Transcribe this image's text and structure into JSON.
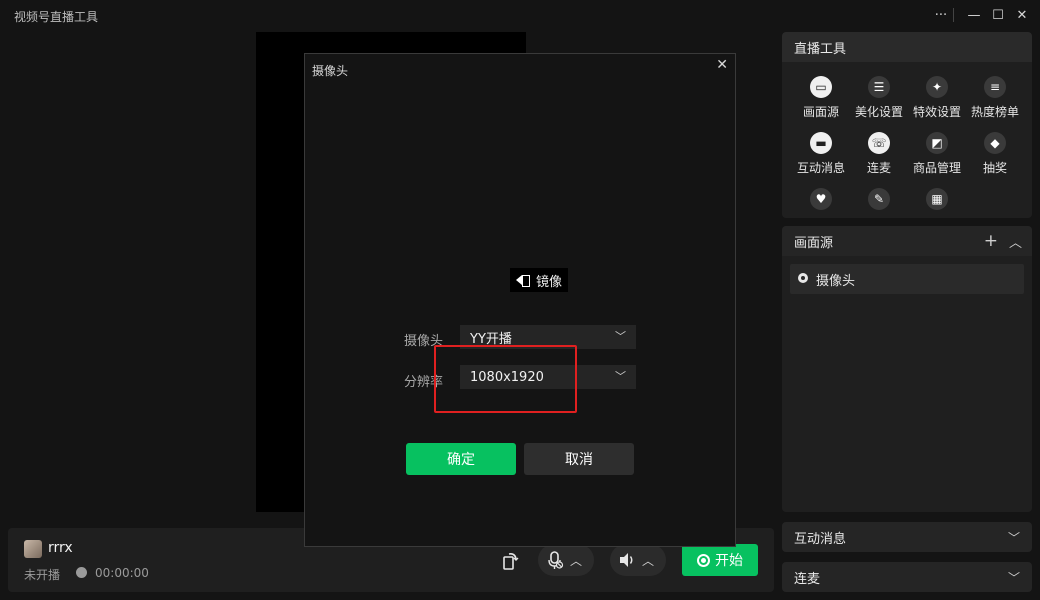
{
  "app": {
    "title": "视频号直播工具"
  },
  "window_controls": {
    "more": "···",
    "minimize": "—",
    "maximize": "☐",
    "close": "✕"
  },
  "user": {
    "name": "rrrx",
    "status": "未开播",
    "duration": "00:00:00"
  },
  "bottom_controls": {
    "start_label": "开始",
    "chevron": "︿"
  },
  "tools": {
    "header": "直播工具",
    "items": [
      {
        "label": "画面源",
        "icon": "screen-icon"
      },
      {
        "label": "美化设置",
        "icon": "sliders-icon"
      },
      {
        "label": "特效设置",
        "icon": "sparkle-icon"
      },
      {
        "label": "热度榜单",
        "icon": "list-icon"
      },
      {
        "label": "互动消息",
        "icon": "chat-icon"
      },
      {
        "label": "连麦",
        "icon": "phone-icon"
      },
      {
        "label": "商品管理",
        "icon": "bag-icon"
      },
      {
        "label": "抽奖",
        "icon": "gift-icon"
      }
    ]
  },
  "scenes": {
    "header": "画面源",
    "items": [
      {
        "label": "摄像头"
      }
    ]
  },
  "collapsed_panels": {
    "interact": "互动消息",
    "link": "连麦"
  },
  "dialog": {
    "title": "摄像头",
    "close": "✕",
    "mirror_label": "镜像",
    "camera_label": "摄像头",
    "camera_value": "YY开播",
    "resolution_label": "分辨率",
    "resolution_value": "1080x1920",
    "confirm": "确定",
    "cancel": "取消"
  },
  "colors": {
    "accent": "#07c160",
    "highlight": "#e02020",
    "background": "#141414"
  }
}
